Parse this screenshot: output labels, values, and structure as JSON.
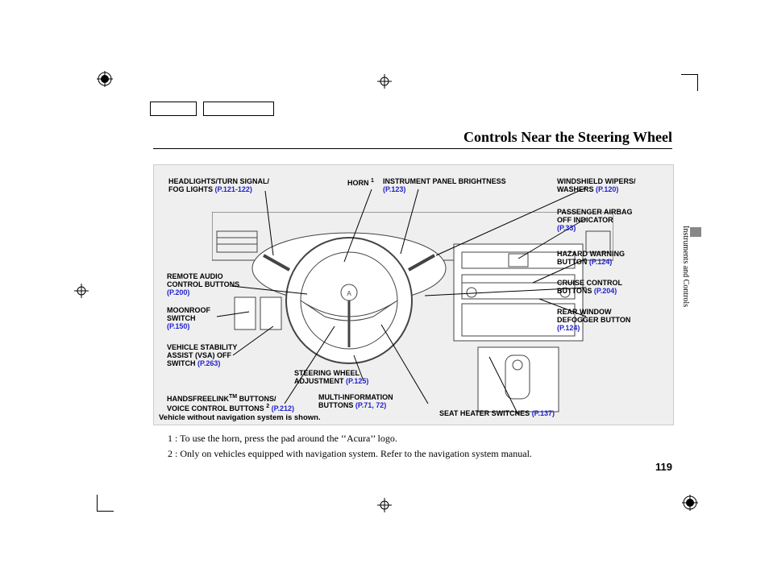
{
  "page": {
    "title": "Controls Near the Steering Wheel",
    "side_tab": "Instruments and Controls",
    "page_number": "119"
  },
  "labels": {
    "headlights": {
      "t1": "HEADLIGHTS/TURN SIGNAL/",
      "t2": "FOG LIGHTS",
      "pg": "(P.121-122)"
    },
    "horn": {
      "t1": "HORN",
      "sup": "1"
    },
    "ipb": {
      "t1": "INSTRUMENT PANEL BRIGHTNESS",
      "pg": "(P.123)"
    },
    "wipers": {
      "t1": "WINDSHIELD WIPERS/",
      "t2": "WASHERS",
      "pg": "(P.120)"
    },
    "airbag": {
      "t1": "PASSENGER AIRBAG",
      "t2": "OFF INDICATOR",
      "pg": "(P.33)"
    },
    "hazard": {
      "t1": "HAZARD WARNING",
      "t2": "BUTTON",
      "pg": "(P.124)"
    },
    "cruise": {
      "t1": "CRUISE CONTROL",
      "t2": "BUTTONS",
      "pg": "(P.204)"
    },
    "defog": {
      "t1": "REAR WINDOW",
      "t2": "DEFOGGER BUTTON",
      "pg": "(P.124)"
    },
    "remote": {
      "t1": "REMOTE AUDIO",
      "t2": "CONTROL BUTTONS",
      "pg": "(P.200)"
    },
    "moonroof": {
      "t1": "MOONROOF",
      "t2": "SWITCH",
      "pg": "(P.150)"
    },
    "vsa": {
      "t1": "VEHICLE STABILITY",
      "t2": "ASSIST (VSA) OFF",
      "t3": "SWITCH",
      "pg": "(P.263)"
    },
    "hfl": {
      "t1": "HANDSFREELINK",
      "tm": "TM",
      "t2": " BUTTONS/",
      "t3": "VOICE CONTROL BUTTONS",
      "sup": "2",
      "pg": "(P.212)"
    },
    "steer": {
      "t1": "STEERING WHEEL",
      "t2": "ADJUSTMENT",
      "pg": "(P.125)"
    },
    "multi": {
      "t1": "MULTI-INFORMATION",
      "t2": "BUTTONS",
      "pg": "(P.71, 72)"
    },
    "seat": {
      "t1": "SEAT HEATER SWITCHES",
      "pg": "(P.137)"
    }
  },
  "caption": "Vehicle without navigation system is shown.",
  "footnotes": {
    "f1": "1 :  To use the horn, press the pad around the ‘‘Acura’’ logo.",
    "f2": "2 :  Only on vehicles equipped with navigation system. Refer to the navigation system manual."
  }
}
